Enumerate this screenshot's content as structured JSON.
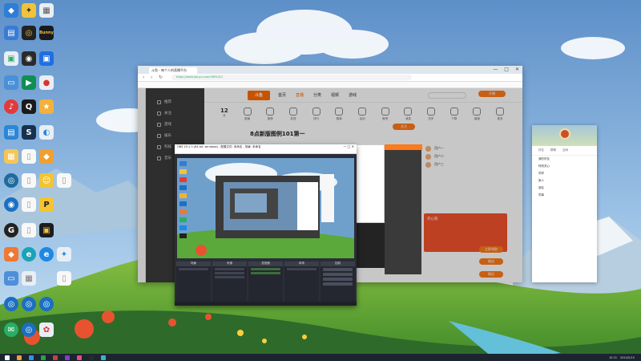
{
  "desktop": {
    "icons": [
      {
        "name": "Microsoft",
        "color": "#2e7dd7",
        "glyph": "◆"
      },
      {
        "name": "Bunny",
        "color": "#3b3b3b",
        "glyph": "B"
      },
      {
        "name": "Blender",
        "color": "#2b6fc4",
        "glyph": "◈"
      },
      {
        "name": "OBS",
        "color": "#2a2a2a",
        "glyph": "◉"
      },
      {
        "name": "Docker",
        "color": "#1f6fe0",
        "glyph": "▣"
      },
      {
        "name": "Live",
        "color": "#e04545",
        "glyph": "●"
      },
      {
        "name": "QQ",
        "color": "#1b1b1b",
        "glyph": "Q"
      },
      {
        "name": "Steam",
        "color": "#16324f",
        "glyph": "S"
      },
      {
        "name": "Store",
        "color": "#1e88e5",
        "glyph": "◐"
      }
    ],
    "row3_label": "Bunny",
    "icon_label_generic": "新建"
  },
  "browser": {
    "tab_label": "斗鱼 - 每个人的直播平台",
    "url": "https://www.douyu.com/7891011",
    "window_controls": [
      "—",
      "□",
      "✕"
    ],
    "nav_buttons": [
      "‹",
      "›",
      "↻"
    ],
    "site_logo": "斗鱼",
    "header_nav": [
      {
        "label": "首页",
        "active": false
      },
      {
        "label": "直播",
        "active": true
      },
      {
        "label": "分类",
        "active": false
      },
      {
        "label": "视频",
        "active": false
      },
      {
        "label": "游戏",
        "active": false
      }
    ],
    "sidebar": [
      "推荐",
      "关注",
      "游戏",
      "娱乐",
      "科技",
      "音乐"
    ],
    "categories": [
      {
        "label": "12",
        "sub": "月"
      },
      {
        "label": "频道"
      },
      {
        "label": "推荐"
      },
      {
        "label": "发现"
      },
      {
        "label": "排行"
      },
      {
        "label": "赛事"
      },
      {
        "label": "活动"
      },
      {
        "label": "鱼吧"
      },
      {
        "label": "消息"
      },
      {
        "label": "历史"
      },
      {
        "label": "下载"
      },
      {
        "label": "客服"
      },
      {
        "label": "更多"
      }
    ],
    "stream_title": "8点新版图例101第一",
    "subscribe_label": "关注",
    "open_button": "开播",
    "gift_rows": [
      "用户一",
      "用户二",
      "用户三"
    ],
    "promo_title": "开心购",
    "promo_button": "立即领取",
    "side_button_1": "赠送",
    "side_button_2": "赠送"
  },
  "obs": {
    "title": "OBS 29.1.3 (64-bit, windows) - 配置文件: 未命名 - 场景: 未命名",
    "docks": [
      "场景",
      "来源",
      "混音器",
      "转场",
      "控制"
    ],
    "controls": [
      "开始直播",
      "开始录制",
      "工作室模式",
      "设置",
      "退出"
    ]
  },
  "chat": {
    "tabs": [
      "好友",
      "群聊",
      "空间"
    ],
    "rows": [
      "我的好友",
      "特别关心",
      "同学",
      "家人",
      "朋友",
      "同事"
    ]
  },
  "taskbar": {
    "time": "10:31",
    "date": "2024/5/15",
    "apps": [
      "#e8a33b",
      "#3b8ee8",
      "#2aa146",
      "#c84040",
      "#8040c8",
      "#e84a8a",
      "#2a2a2a",
      "#40b0c8"
    ]
  }
}
